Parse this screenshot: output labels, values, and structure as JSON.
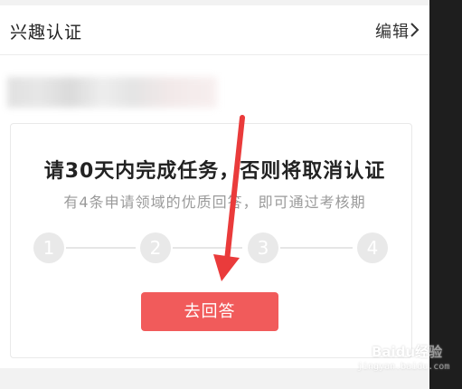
{
  "header": {
    "title": "兴趣认证",
    "edit_label": "编辑"
  },
  "task": {
    "title": "请30天内完成任务，否则将取消认证",
    "subtitle": "有4条申请领域的优质回答，即可通过考核期",
    "steps": [
      "1",
      "2",
      "3",
      "4"
    ],
    "answer_button": "去回答"
  },
  "watermark": {
    "text": "Baidu经验",
    "url": "jingyan.baidu.com"
  },
  "colors": {
    "accent": "#f15b5b",
    "arrow": "#ea3b3b",
    "step": "#e9e9e9"
  },
  "icons": {
    "edit_chevron": "chevron-right-icon",
    "annotation": "red-arrow-icon"
  }
}
